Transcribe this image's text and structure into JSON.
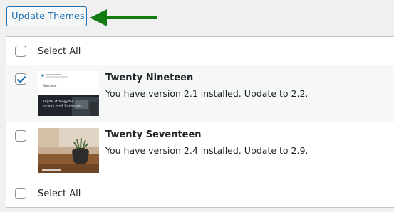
{
  "toolbar": {
    "update_button_label": "Update Themes"
  },
  "annotation": {
    "arrow_color": "#127c12"
  },
  "select_all_label": "Select All",
  "themes": [
    {
      "name": "Twenty Nineteen",
      "description": "You have version 2.1 installed. Update to 2.2.",
      "checked": true,
      "thumbnail_text": [
        "Welcome",
        "Digital strategy for",
        "unique small businesses"
      ]
    },
    {
      "name": "Twenty Seventeen",
      "description": "You have version 2.4 installed. Update to 2.9.",
      "checked": false
    }
  ],
  "colors": {
    "accent": "#2271b1",
    "check": "#2271b1"
  }
}
